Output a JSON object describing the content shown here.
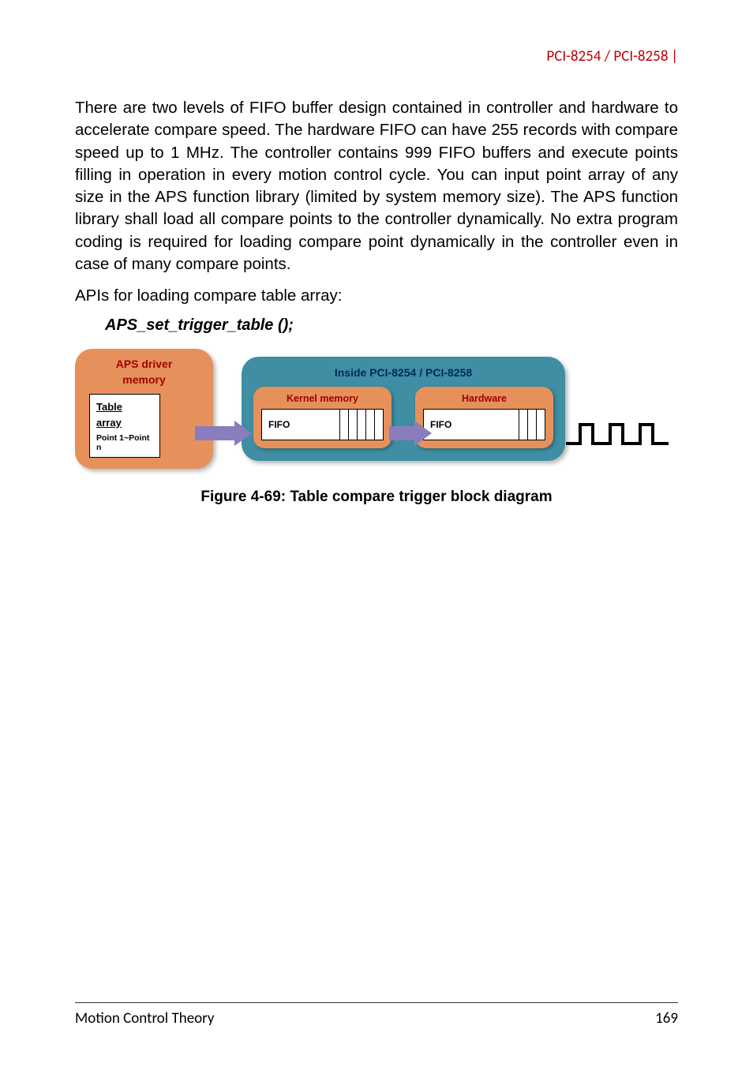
{
  "header": {
    "title": "PCI-8254 / PCI-8258"
  },
  "body": {
    "p1": "There are two levels of FIFO buffer design contained in controller and hardware to accelerate compare speed. The hardware FIFO can have 255 records with compare speed up to 1 MHz. The controller contains 999 FIFO buffers and execute points filling in operation in every motion control cycle. You can input point array of any size in the APS function library (limited by system memory size). The APS function library shall load all compare points to the controller dynamically. No extra program coding is required for loading compare point dynamically in the controller even in case of many compare points.",
    "p2": "APIs for loading compare table array:",
    "api_call": "APS_set_trigger_table ();"
  },
  "diagram": {
    "driver": {
      "title_line1": "APS driver",
      "title_line2": "memory",
      "table_label_line1": "Table",
      "table_label_line2": "array",
      "points": "Point 1~Point n"
    },
    "pci": {
      "title": "Inside PCI-8254 / PCI-8258",
      "kernel_title": "Kernel memory",
      "hardware_title": "Hardware",
      "fifo_label": "FIFO"
    }
  },
  "figure_caption": "Figure 4-69: Table compare trigger block diagram",
  "footer": {
    "left": "Motion Control Theory",
    "right": "169"
  }
}
